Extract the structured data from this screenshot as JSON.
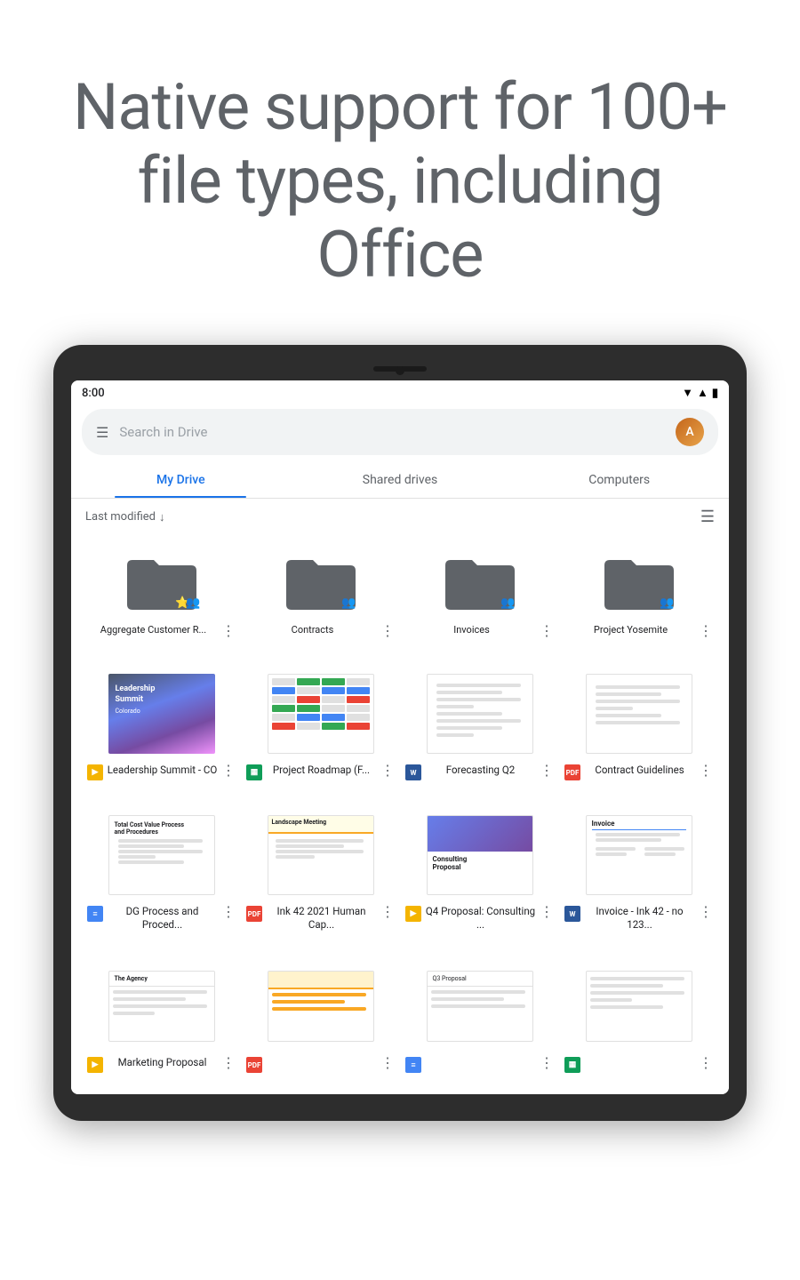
{
  "hero": {
    "title": "Native support for 100+ file types, including Office"
  },
  "statusBar": {
    "time": "8:00",
    "icons": "▼▲📶"
  },
  "searchBar": {
    "placeholder": "Search in Drive"
  },
  "tabs": [
    {
      "label": "My Drive",
      "active": true
    },
    {
      "label": "Shared drives",
      "active": false
    },
    {
      "label": "Computers",
      "active": false
    }
  ],
  "sortBar": {
    "label": "Last modified",
    "arrow": "↓"
  },
  "folders": [
    {
      "name": "Aggregate Customer R...",
      "shared": true,
      "starred": true
    },
    {
      "name": "Contracts",
      "shared": true
    },
    {
      "name": "Invoices",
      "shared": true
    },
    {
      "name": "Project Yosemite",
      "shared": true
    }
  ],
  "files_row1": [
    {
      "name": "Leadership Summit - CO",
      "type": "slides",
      "typeLabel": "▶"
    },
    {
      "name": "Project Roadmap (F...",
      "type": "sheets",
      "typeLabel": "▦"
    },
    {
      "name": "Forecasting Q2",
      "type": "word",
      "typeLabel": "W"
    },
    {
      "name": "Contract Guidelines",
      "type": "pdf",
      "typeLabel": "PDF"
    }
  ],
  "files_row2": [
    {
      "name": "DG Process and Proced...",
      "type": "docs",
      "typeLabel": "≡"
    },
    {
      "name": "Ink 42 2021 Human Cap...",
      "type": "pdf",
      "typeLabel": "PDF"
    },
    {
      "name": "Q4 Proposal: Consulting ...",
      "type": "slides",
      "typeLabel": "▶"
    },
    {
      "name": "Invoice - Ink 42 - no 123...",
      "type": "word",
      "typeLabel": "W"
    }
  ],
  "files_row3": [
    {
      "name": "Marketing Proposal",
      "type": "slides"
    },
    {
      "name": "",
      "type": "pdf"
    },
    {
      "name": "",
      "type": "docs"
    },
    {
      "name": "",
      "type": "sheets"
    }
  ],
  "colors": {
    "primary": "#1a73e8",
    "tabActive": "#1a73e8",
    "text": "#202124",
    "textSecondary": "#5f6368"
  }
}
